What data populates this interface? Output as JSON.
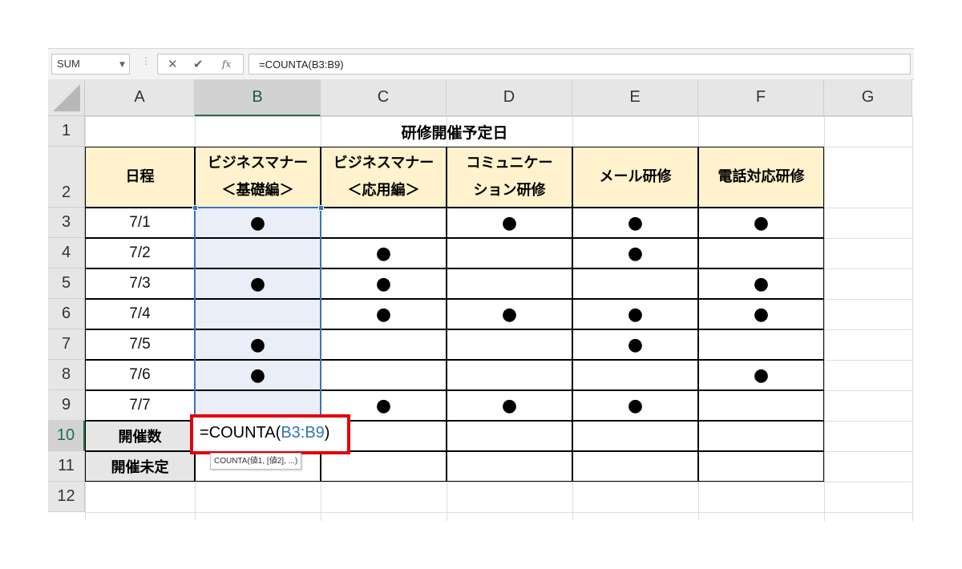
{
  "formula_bar": {
    "name_box": "SUM",
    "cancel_icon": "✕",
    "enter_icon": "✔",
    "fx_label": "fx",
    "formula": "=COUNTA(B3:B9)"
  },
  "columns": [
    "A",
    "B",
    "C",
    "D",
    "E",
    "F",
    "G"
  ],
  "rows": [
    "1",
    "2",
    "3",
    "4",
    "5",
    "6",
    "7",
    "8",
    "9",
    "10",
    "11",
    "12"
  ],
  "sheet": {
    "title": "研修開催予定日",
    "header_date": "日程",
    "headers": [
      [
        "ビジネスマナー",
        "＜基礎編＞"
      ],
      [
        "ビジネスマナー",
        "＜応用編＞"
      ],
      [
        "コミュニケー",
        "ション研修"
      ],
      [
        "メール研修"
      ],
      [
        "電話対応研修"
      ]
    ],
    "dates": [
      "7/1",
      "7/2",
      "7/3",
      "7/4",
      "7/5",
      "7/6",
      "7/7"
    ],
    "marks": [
      [
        "●",
        "",
        "●",
        "●",
        "●"
      ],
      [
        "",
        "●",
        "",
        "●",
        ""
      ],
      [
        "●",
        "●",
        "",
        "",
        "●"
      ],
      [
        "",
        "●",
        "●",
        "●",
        "●"
      ],
      [
        "●",
        "",
        "",
        "●",
        ""
      ],
      [
        "●",
        "",
        "",
        "",
        "●"
      ],
      [
        "",
        "●",
        "●",
        "●",
        ""
      ]
    ],
    "count_label": "開催数",
    "undecided_label": "開催未定"
  },
  "editing": {
    "prefix": "=COUNTA(",
    "ref": "B3:B9",
    "suffix": ")",
    "tooltip": "COUNTA(値1, [値2], ...)"
  }
}
